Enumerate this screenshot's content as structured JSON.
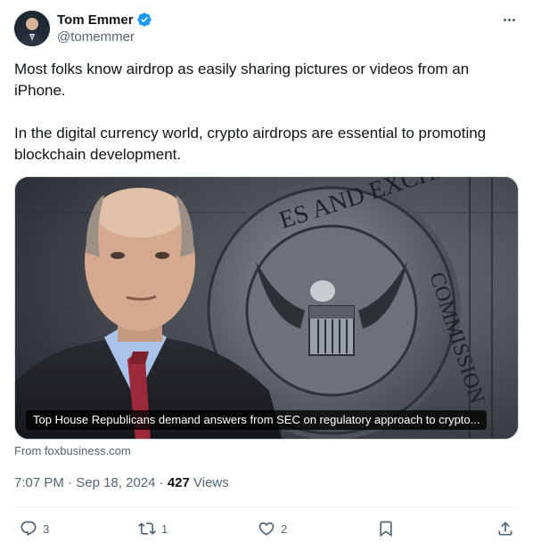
{
  "author": {
    "display_name": "Tom Emmer",
    "handle": "@tomemmer",
    "verified": true
  },
  "tweet": {
    "paragraphs": [
      "Most folks know airdrop as easily sharing pictures or videos from an iPhone.",
      "In the digital currency world, crypto airdrops are essential to promoting blockchain development."
    ]
  },
  "card": {
    "seal_text_top": "ES AND EXCHANGE",
    "seal_text_right": "COMMISSION",
    "caption": "Top House Republicans demand answers from SEC on regulatory approach to crypto...",
    "source": "From foxbusiness.com"
  },
  "meta": {
    "time": "7:07 PM",
    "date": "Sep 18, 2024",
    "views_count": "427",
    "views_label": "Views"
  },
  "actions": {
    "replies": "3",
    "reposts": "1",
    "likes": "2"
  },
  "colors": {
    "verified_blue": "#1d9bf0",
    "text_primary": "#0f1419",
    "text_secondary": "#536471"
  }
}
